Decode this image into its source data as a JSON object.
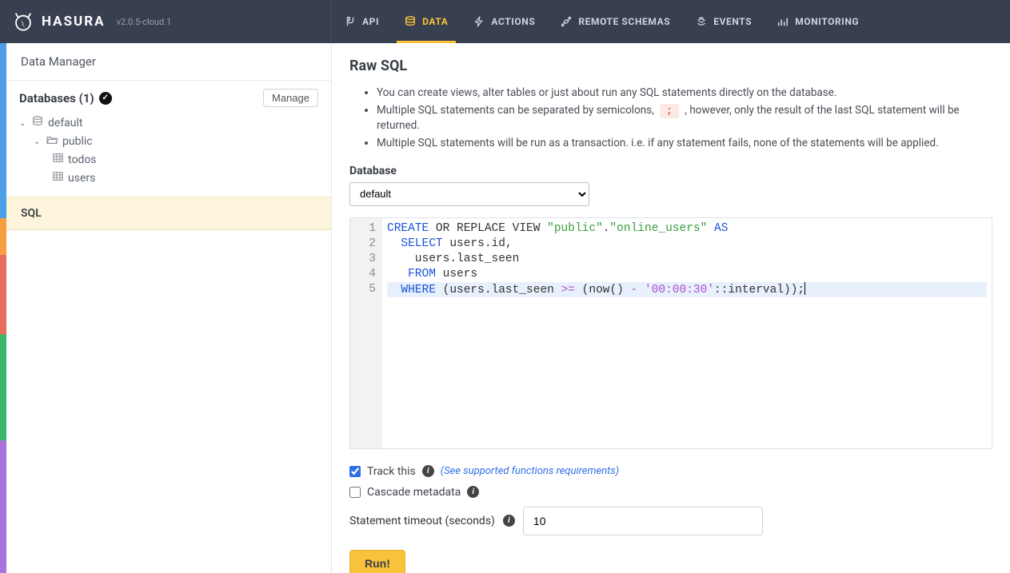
{
  "brand": {
    "name": "HASURA",
    "version": "v2.0.5-cloud.1"
  },
  "nav": [
    {
      "label": "API",
      "active": false
    },
    {
      "label": "DATA",
      "active": true
    },
    {
      "label": "ACTIONS",
      "active": false
    },
    {
      "label": "REMOTE SCHEMAS",
      "active": false
    },
    {
      "label": "EVENTS",
      "active": false
    },
    {
      "label": "MONITORING",
      "active": false
    }
  ],
  "sidebar": {
    "header": "Data Manager",
    "databases_label": "Databases (1)",
    "manage_label": "Manage",
    "db_name": "default",
    "schema_name": "public",
    "tables": [
      "todos",
      "users"
    ],
    "sql_label": "SQL"
  },
  "main": {
    "title": "Raw SQL",
    "bullets": {
      "b1": "You can create views, alter tables or just about run any SQL statements directly on the database.",
      "b2a": "Multiple SQL statements can be separated by semicolons, ",
      "b2b": ";",
      "b2c": " , however, only the result of the last SQL statement will be returned.",
      "b3": "Multiple SQL statements will be run as a transaction. i.e. if any statement fails, none of the statements will be applied."
    },
    "database_label": "Database",
    "database_value": "default",
    "track_label": "Track this",
    "supported_link": "(See supported functions requirements)",
    "cascade_label": "Cascade metadata",
    "timeout_label": "Statement timeout (seconds)",
    "timeout_value": "10",
    "run_label": "Run!",
    "sql": {
      "lines": [
        {
          "pre": "",
          "segs": [
            [
              "kw",
              "CREATE"
            ],
            [
              "",
              null,
              " OR REPLACE VIEW "
            ],
            [
              "tok-name",
              "\"public\""
            ],
            [
              "",
              null,
              "."
            ],
            [
              "tok-name",
              "\"online_users\""
            ],
            [
              "",
              null,
              " "
            ],
            [
              "kw",
              "AS"
            ]
          ]
        },
        {
          "pre": "  ",
          "segs": [
            [
              "kw",
              "SELECT"
            ],
            [
              "",
              null,
              " users.id,"
            ]
          ]
        },
        {
          "pre": "    ",
          "segs": [
            [
              "",
              null,
              "users.last_seen"
            ]
          ]
        },
        {
          "pre": "   ",
          "segs": [
            [
              "kw",
              "FROM"
            ],
            [
              "",
              null,
              " users"
            ]
          ]
        },
        {
          "pre": "  ",
          "hl": true,
          "cursor": true,
          "segs": [
            [
              "kw",
              "WHERE"
            ],
            [
              "",
              null,
              " (users.last_seen "
            ],
            [
              "tok-op",
              ">="
            ],
            [
              "",
              null,
              " (now() "
            ],
            [
              "tok-op",
              "-"
            ],
            [
              "",
              null,
              " "
            ],
            [
              "tok-str",
              "'00:00:30'"
            ],
            [
              "",
              null,
              "::interval));"
            ]
          ]
        }
      ]
    }
  }
}
